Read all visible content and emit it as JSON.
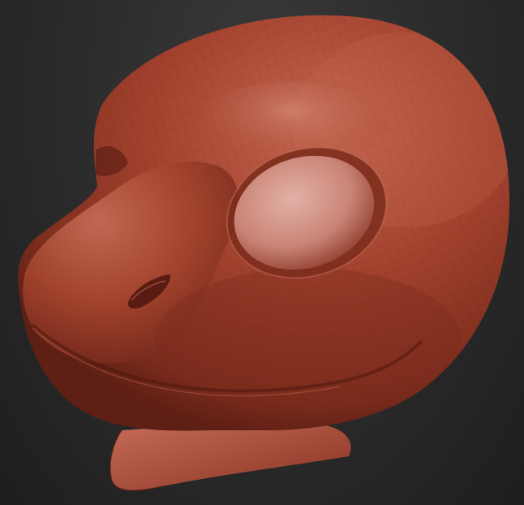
{
  "scene": {
    "background_color": "#2a2a2a",
    "subject": "sculpted-head-mesh",
    "material_colors": {
      "base": "#a4432f",
      "highlight": "#c56a55",
      "shadow": "#5e1f14",
      "socket": "#d69a8e",
      "wire": "#7a2a1c"
    }
  }
}
